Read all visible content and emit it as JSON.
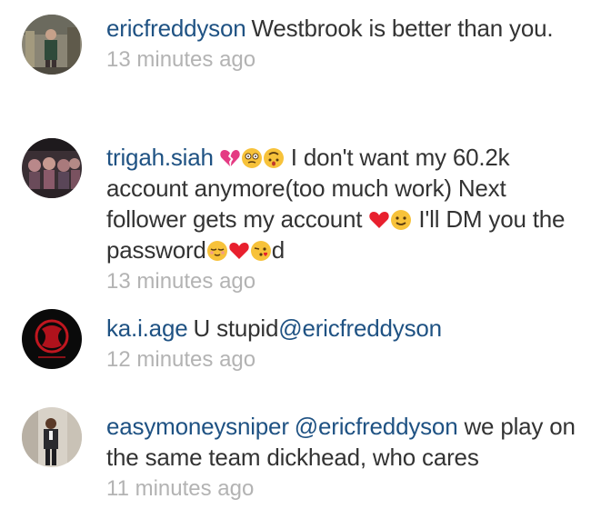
{
  "comments": [
    {
      "username": "ericfreddyson",
      "text": "Westbrook is better than you.",
      "time": "13 minutes ago"
    },
    {
      "username": "trigah.siah",
      "text_part1": " I don't want my 60.2k account  anymore(too much work) Next follower gets my account ",
      "text_part2": " I'll DM you the password",
      "text_part3": "d",
      "time": "13 minutes ago"
    },
    {
      "username": "ka.i.age",
      "text": "U stupid",
      "mention": "@ericfreddyson",
      "time": "12 minutes ago"
    },
    {
      "username": "easymoneysniper",
      "mention": "@ericfreddyson",
      "text": " we play on the same team dickhead, who cares",
      "time": "11 minutes ago"
    }
  ],
  "icons": {
    "broken_heart": "broken-heart-icon",
    "dizzy_face": "dizzy-face-icon",
    "upside_down_face": "upside-down-face-icon",
    "red_heart": "red-heart-icon",
    "smiling_face": "smiling-face-icon",
    "relieved_face": "relieved-face-icon",
    "kissing_face": "kissing-face-icon"
  },
  "colors": {
    "username": "#1f5283",
    "text": "#333333",
    "timestamp": "#b3b3b3",
    "heart": "#e8202e",
    "emoji_yellow": "#f7c23a"
  }
}
